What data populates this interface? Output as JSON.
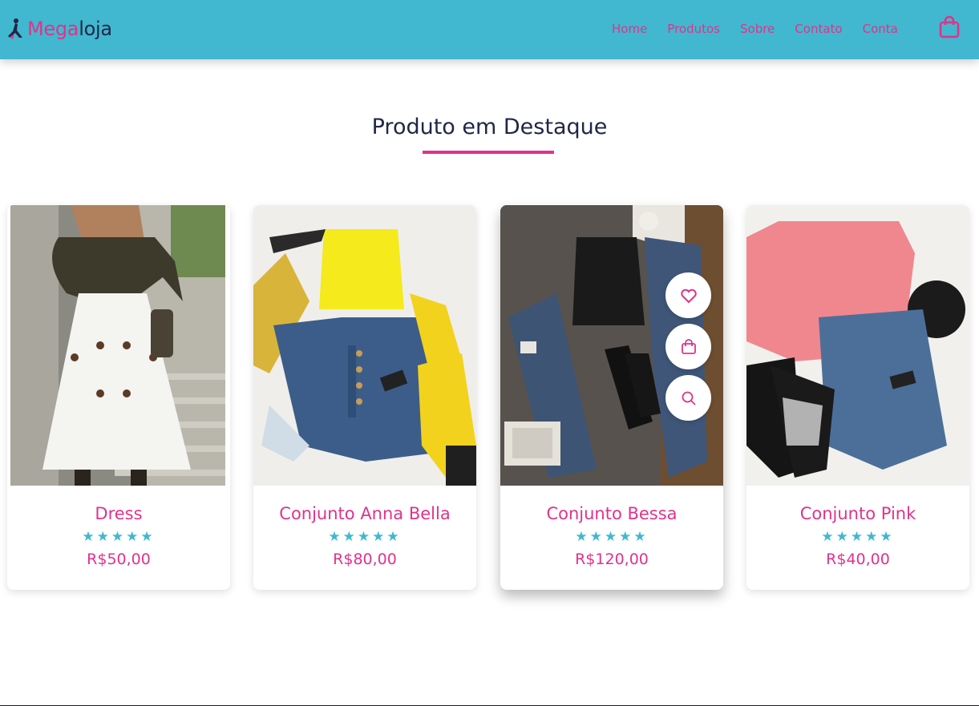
{
  "brand": {
    "part1": "Mega",
    "part2": "loja"
  },
  "nav": [
    "Home",
    "Produtos",
    "Sobre",
    "Contato",
    "Conta"
  ],
  "section": {
    "title": "Produto em Destaque"
  },
  "products": [
    {
      "name": "Dress",
      "stars": "★★★★★",
      "price": "R$50,00"
    },
    {
      "name": "Conjunto Anna Bella",
      "stars": "★★★★★",
      "price": "R$80,00"
    },
    {
      "name": "Conjunto Bessa",
      "stars": "★★★★★",
      "price": "R$120,00"
    },
    {
      "name": "Conjunto Pink",
      "stars": "★★★★★",
      "price": "R$40,00"
    }
  ],
  "icons": {
    "cart": "shopping-bag-icon",
    "wishlist": "heart-icon",
    "add_to_cart": "shopping-bag-icon",
    "quick_view": "magnifier-icon"
  },
  "colors": {
    "header": "#41b8cf",
    "accent": "#e0338a",
    "dark": "#222647"
  }
}
